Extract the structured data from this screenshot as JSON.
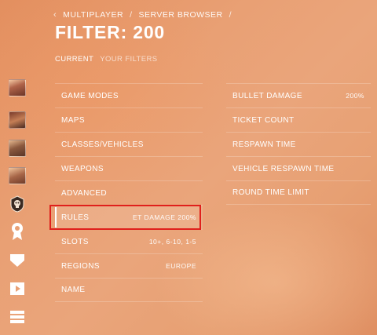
{
  "breadcrumb": {
    "back_icon": "chevron-left-icon",
    "items": [
      "MULTIPLAYER",
      "SERVER BROWSER"
    ],
    "separator": "/"
  },
  "title": "FILTER: 200",
  "tabs": [
    {
      "label": "CURRENT",
      "active": true
    },
    {
      "label": "YOUR FILTERS",
      "active": false
    }
  ],
  "sidebar": {
    "icons": [
      "avatar-1",
      "avatar-2",
      "avatar-3",
      "avatar-4",
      "skull-emblem-icon",
      "medal-icon",
      "shield-icon",
      "play-icon",
      "list-icon"
    ]
  },
  "left_list": [
    {
      "label": "GAME MODES",
      "value": ""
    },
    {
      "label": "MAPS",
      "value": ""
    },
    {
      "label": "CLASSES/VEHICLES",
      "value": ""
    },
    {
      "label": "WEAPONS",
      "value": ""
    },
    {
      "label": "ADVANCED",
      "value": ""
    },
    {
      "label": "RULES",
      "value": "ET DAMAGE 200%",
      "highlighted": true
    },
    {
      "label": "SLOTS",
      "value": "10+, 6-10, 1-5"
    },
    {
      "label": "REGIONS",
      "value": "EUROPE"
    },
    {
      "label": "NAME",
      "value": ""
    }
  ],
  "right_list": [
    {
      "label": "BULLET DAMAGE",
      "value": "200%"
    },
    {
      "label": "TICKET COUNT",
      "value": ""
    },
    {
      "label": "RESPAWN TIME",
      "value": ""
    },
    {
      "label": "VEHICLE RESPAWN TIME",
      "value": ""
    },
    {
      "label": "ROUND TIME LIMIT",
      "value": ""
    }
  ],
  "colors": {
    "background": "#e9a074",
    "highlight_border": "#e0201c",
    "text": "#ffffff"
  }
}
